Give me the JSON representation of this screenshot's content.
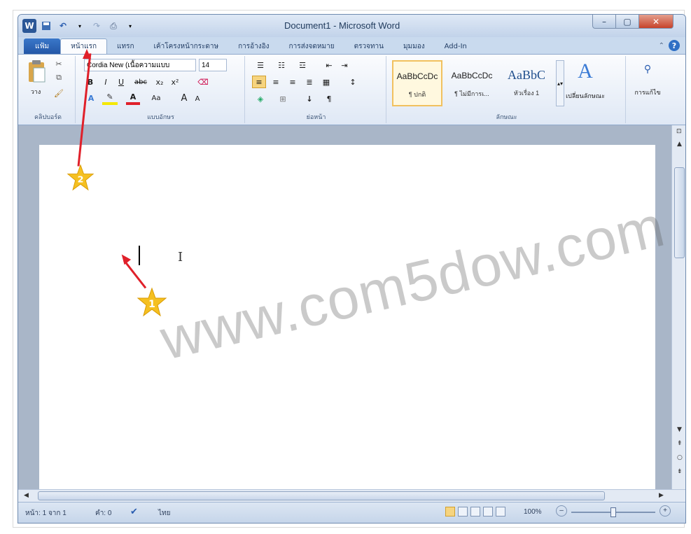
{
  "window": {
    "title": "Document1 - Microsoft Word",
    "qat_icons": [
      "word-icon",
      "save-icon",
      "undo-icon",
      "redo-icon",
      "print-preview-icon",
      "customize-icon"
    ]
  },
  "tabs": [
    {
      "label": "แฟ้ม",
      "active": false,
      "file": true
    },
    {
      "label": "หน้าแรก",
      "active": true
    },
    {
      "label": "แทรก",
      "active": false
    },
    {
      "label": "เค้าโครงหน้ากระดาษ",
      "active": false
    },
    {
      "label": "การอ้างอิง",
      "active": false
    },
    {
      "label": "การส่งจดหมาย",
      "active": false
    },
    {
      "label": "ตรวจทาน",
      "active": false
    },
    {
      "label": "มุมมอง",
      "active": false
    },
    {
      "label": "Add-In",
      "active": false
    }
  ],
  "ribbon": {
    "clipboard": {
      "paste_label": "วาง",
      "group_label": "คลิปบอร์ด"
    },
    "font": {
      "font_name": "Cordia New (เนื้อความแบบ",
      "font_size": "14",
      "group_label": "แบบอักษร",
      "bold": "B",
      "italic": "I",
      "underline": "U",
      "strike": "abc",
      "sub": "x₂",
      "sup": "x²",
      "font_color": "A",
      "change_case": "Aa",
      "grow": "A",
      "shrink": "A"
    },
    "paragraph": {
      "group_label": "ย่อหน้า",
      "sort": "↓",
      "pilcrow": "¶"
    },
    "styles": {
      "group_label": "ลักษณะ",
      "items": [
        {
          "preview": "AaBbCcDc",
          "name": "¶ ปกติ",
          "selected": true
        },
        {
          "preview": "AaBbCcDc",
          "name": "¶ ไม่มีการเ...",
          "selected": false
        },
        {
          "preview": "AaBbC",
          "name": "หัวเรื่อง 1",
          "selected": false
        }
      ],
      "change_styles_label": "เปลี่ยนลักษณะ"
    },
    "editing": {
      "label": "การแก้ไข"
    }
  },
  "document": {
    "watermark": "www.com5dow.com",
    "annotations": [
      {
        "number": "1"
      },
      {
        "number": "2"
      }
    ]
  },
  "status": {
    "page": "หน้า: 1 จาก 1",
    "words": "คำ: 0",
    "language": "ไทย",
    "zoom": "100%"
  },
  "colors": {
    "file_tab": "#2b62b5",
    "arrow": "#e0202a",
    "star": "#f5c020",
    "selected_style": "#f1c15f"
  }
}
